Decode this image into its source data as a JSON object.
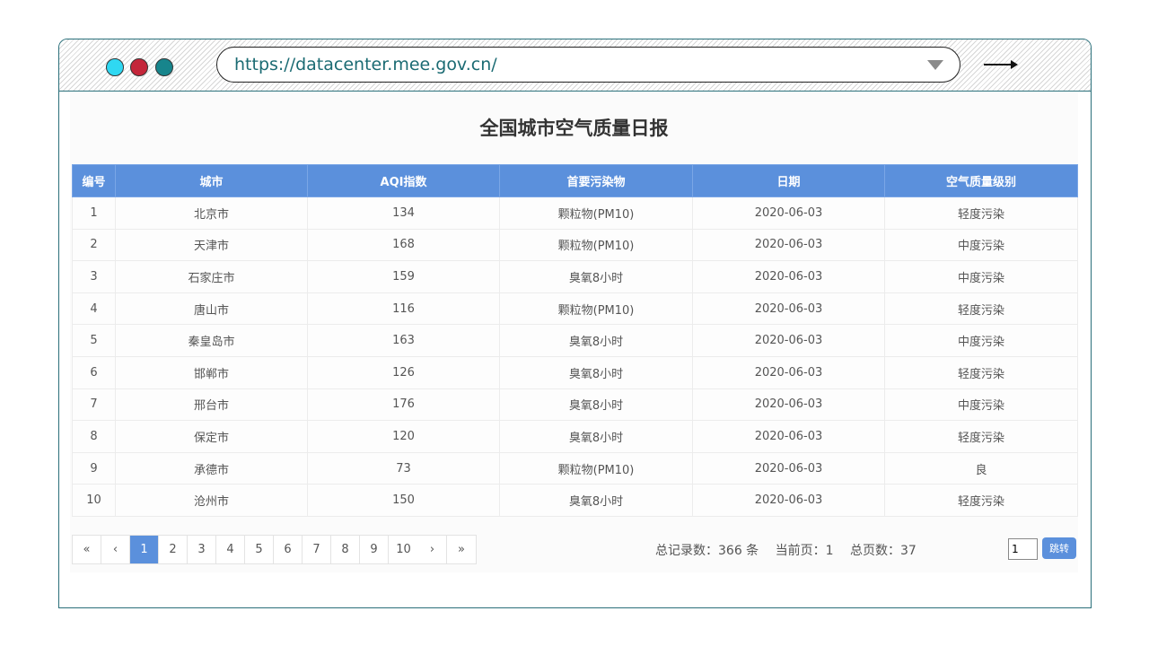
{
  "browser": {
    "url": "https://datacenter.mee.gov.cn/",
    "dot_colors": [
      "#2fd8f2",
      "#c4263a",
      "#17858c"
    ]
  },
  "page": {
    "title": "全国城市空气质量日报"
  },
  "table": {
    "columns": [
      "编号",
      "城市",
      "AQI指数",
      "首要污染物",
      "日期",
      "空气质量级别"
    ],
    "rows": [
      {
        "no": "1",
        "city": "北京市",
        "aqi": "134",
        "pollutant": "颗粒物(PM10)",
        "date": "2020-06-03",
        "level": "轻度污染",
        "color": "orange"
      },
      {
        "no": "2",
        "city": "天津市",
        "aqi": "168",
        "pollutant": "颗粒物(PM10)",
        "date": "2020-06-03",
        "level": "中度污染",
        "color": "red"
      },
      {
        "no": "3",
        "city": "石家庄市",
        "aqi": "159",
        "pollutant": "臭氧8小时",
        "date": "2020-06-03",
        "level": "中度污染",
        "color": "red"
      },
      {
        "no": "4",
        "city": "唐山市",
        "aqi": "116",
        "pollutant": "颗粒物(PM10)",
        "date": "2020-06-03",
        "level": "轻度污染",
        "color": "orange"
      },
      {
        "no": "5",
        "city": "秦皇岛市",
        "aqi": "163",
        "pollutant": "臭氧8小时",
        "date": "2020-06-03",
        "level": "中度污染",
        "color": "red"
      },
      {
        "no": "6",
        "city": "邯郸市",
        "aqi": "126",
        "pollutant": "臭氧8小时",
        "date": "2020-06-03",
        "level": "轻度污染",
        "color": "orange"
      },
      {
        "no": "7",
        "city": "邢台市",
        "aqi": "176",
        "pollutant": "臭氧8小时",
        "date": "2020-06-03",
        "level": "中度污染",
        "color": "red"
      },
      {
        "no": "8",
        "city": "保定市",
        "aqi": "120",
        "pollutant": "臭氧8小时",
        "date": "2020-06-03",
        "level": "轻度污染",
        "color": "orange"
      },
      {
        "no": "9",
        "city": "承德市",
        "aqi": "73",
        "pollutant": "颗粒物(PM10)",
        "date": "2020-06-03",
        "level": "良",
        "color": "yellow"
      },
      {
        "no": "10",
        "city": "沧州市",
        "aqi": "150",
        "pollutant": "臭氧8小时",
        "date": "2020-06-03",
        "level": "轻度污染",
        "color": "orange"
      }
    ]
  },
  "colors": {
    "header": "#5b90dc",
    "orange": "#f08a24",
    "red": "#e02424",
    "yellow": "#f2c94c",
    "city": "#3f4fc4"
  },
  "pagination": {
    "first": "«",
    "prev": "‹",
    "pages": [
      "1",
      "2",
      "3",
      "4",
      "5",
      "6",
      "7",
      "8",
      "9",
      "10"
    ],
    "next": "›",
    "last": "»",
    "current_index": 0,
    "total_records": "总记录数：366 条",
    "current_page": "当前页：1",
    "total_pages": "总页数：37",
    "jump_value": "1",
    "jump_label": "跳转"
  }
}
